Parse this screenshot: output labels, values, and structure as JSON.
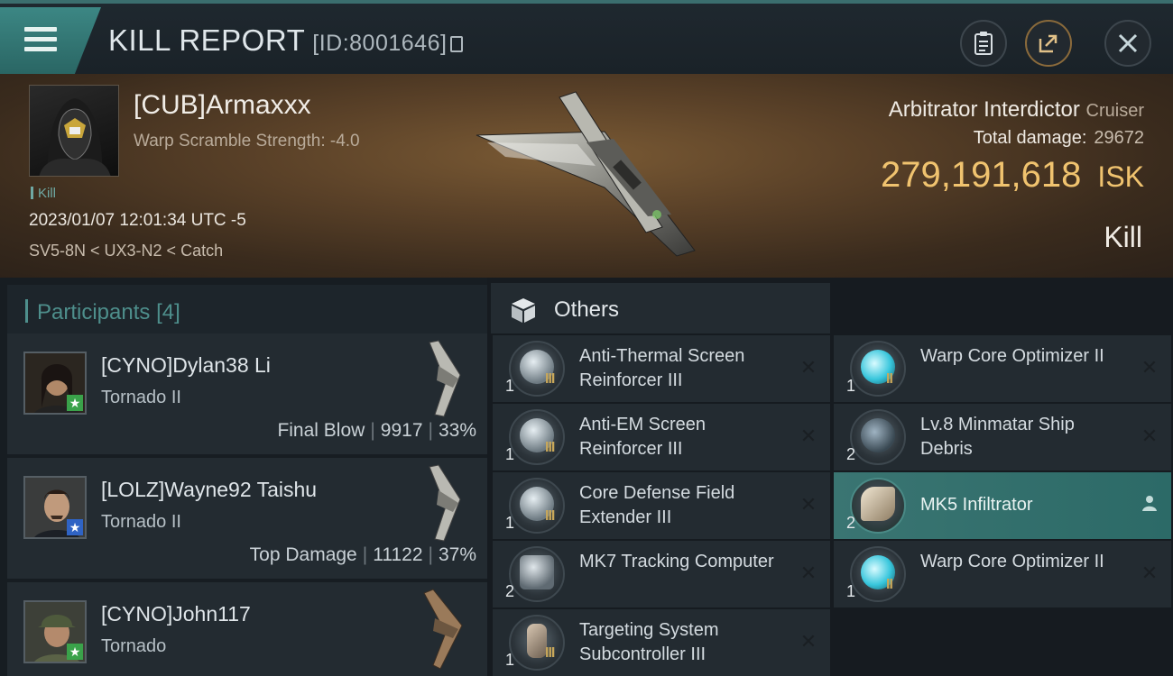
{
  "header": {
    "title": "KILL REPORT",
    "report_id": "[ID:8001646]",
    "buttons": [
      "clipboard-icon",
      "share-icon",
      "close-icon"
    ]
  },
  "victim": {
    "name": "[CUB]Armaxxx",
    "warp_scramble": "Warp Scramble Strength: -4.0",
    "tag": "Kill",
    "datetime": "2023/01/07 12:01:34 UTC -5",
    "location": "SV5-8N < UX3-N2 < Catch",
    "ship": "Arbitrator Interdictor",
    "ship_class": "Cruiser",
    "total_damage_label": "Total damage:",
    "total_damage": "29672",
    "isk_value": "279,191,618",
    "isk_unit": "ISK",
    "result": "Kill"
  },
  "participants": {
    "label": "Participants",
    "count": "[4]",
    "rows": [
      {
        "name": "[CYNO]Dylan38 Li",
        "ship": "Tornado II",
        "role": "Final Blow",
        "damage": "9917",
        "percent": "33%",
        "badge_color": "#3aa24a"
      },
      {
        "name": "[LOLZ]Wayne92 Taishu",
        "ship": "Tornado II",
        "role": "Top Damage",
        "damage": "11122",
        "percent": "37%",
        "badge_color": "#2f63c4"
      },
      {
        "name": "[CYNO]John117",
        "ship": "Tornado",
        "role": "",
        "damage": "",
        "percent": "",
        "badge_color": "#3aa24a"
      }
    ]
  },
  "others": {
    "label": "Others",
    "col1": [
      {
        "name": "Anti-Thermal Screen Reinforcer III",
        "qty": "1",
        "meta": "III",
        "action": "✕"
      },
      {
        "name": "Anti-EM Screen Reinforcer III",
        "qty": "1",
        "meta": "III",
        "action": "✕"
      },
      {
        "name": "Core Defense Field Extender III",
        "qty": "1",
        "meta": "III",
        "action": "✕"
      },
      {
        "name": "MK7 Tracking Computer",
        "qty": "2",
        "meta": "",
        "action": "✕"
      },
      {
        "name": "Targeting System Subcontroller III",
        "qty": "1",
        "meta": "III",
        "action": "✕"
      }
    ],
    "col2": [
      {
        "name": "Warp Core Optimizer II",
        "qty": "1",
        "meta": "II",
        "action": "✕"
      },
      {
        "name": "Lv.8 Minmatar Ship Debris",
        "qty": "2",
        "meta": "",
        "action": "✕"
      },
      {
        "name": "MK5  Infiltrator",
        "qty": "2",
        "meta": "",
        "action": "person-icon",
        "selected": true
      },
      {
        "name": "Warp Core Optimizer II",
        "qty": "1",
        "meta": "II",
        "action": "✕"
      }
    ]
  }
}
